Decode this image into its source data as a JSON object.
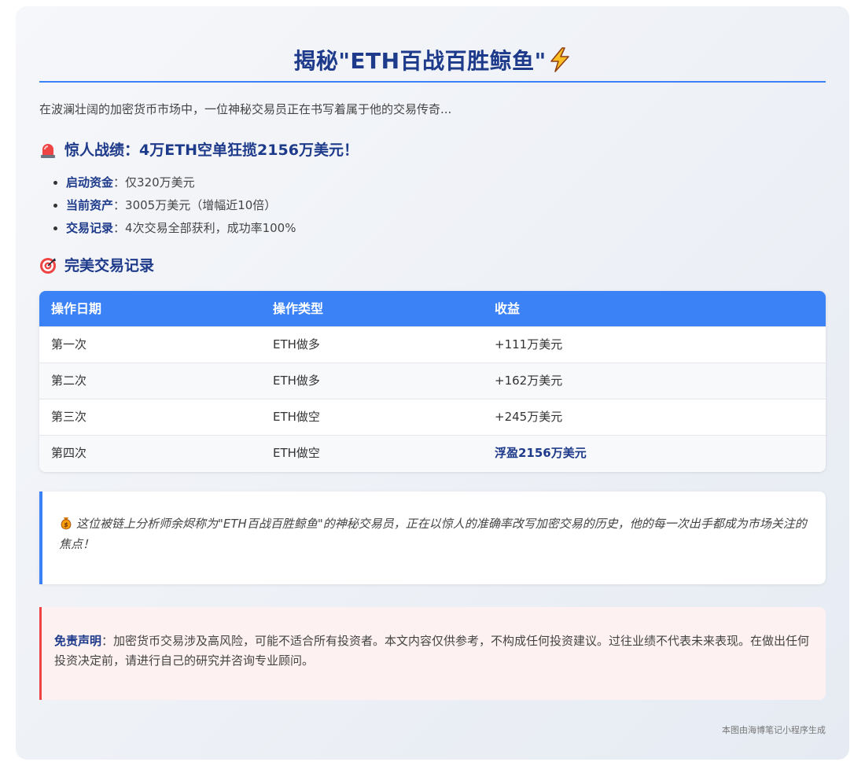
{
  "title": "揭秘\"ETH百战百胜鲸鱼\"",
  "title_icon": "lightning-icon",
  "intro": "在波澜壮阔的加密货币市场中，一位神秘交易员正在书写着属于他的交易传奇...",
  "section1": {
    "icon": "siren-icon",
    "heading": "惊人战绩：4万ETH空单狂揽2156万美元！",
    "bullets": [
      {
        "key": "启动资金",
        "sep": "：",
        "value": "仅320万美元"
      },
      {
        "key": "当前资产",
        "sep": "：",
        "value": "3005万美元（增幅近10倍）"
      },
      {
        "key": "交易记录",
        "sep": "：",
        "value": "4次交易全部获利，成功率100%"
      }
    ]
  },
  "section2": {
    "icon": "target-icon",
    "heading": "完美交易记录"
  },
  "table": {
    "headers": [
      "操作日期",
      "操作类型",
      "收益"
    ],
    "rows": [
      [
        "第一次",
        "ETH做多",
        "+111万美元"
      ],
      [
        "第二次",
        "ETH做多",
        "+162万美元"
      ],
      [
        "第三次",
        "ETH做空",
        "+245万美元"
      ],
      [
        "第四次",
        "ETH做空",
        "浮盈2156万美元"
      ]
    ]
  },
  "quote": {
    "icon": "money-bag-icon",
    "text": "这位被链上分析师余烬称为\"ETH百战百胜鲸鱼\"的神秘交易员，正在以惊人的准确率改写加密交易的历史，他的每一次出手都成为市场关注的焦点！"
  },
  "disclaimer": {
    "label": "免责声明",
    "sep": "：",
    "text": "加密货币交易涉及高风险，可能不适合所有投资者。本文内容仅供参考，不构成任何投资建议。过往业绩不代表未来表现。在做出任何投资决定前，请进行自己的研究并咨询专业顾问。"
  },
  "footer": "本图由海博笔记小程序生成",
  "colors": {
    "accent": "#3b82f6",
    "heading": "#1e3a8a",
    "danger": "#ef4444"
  }
}
